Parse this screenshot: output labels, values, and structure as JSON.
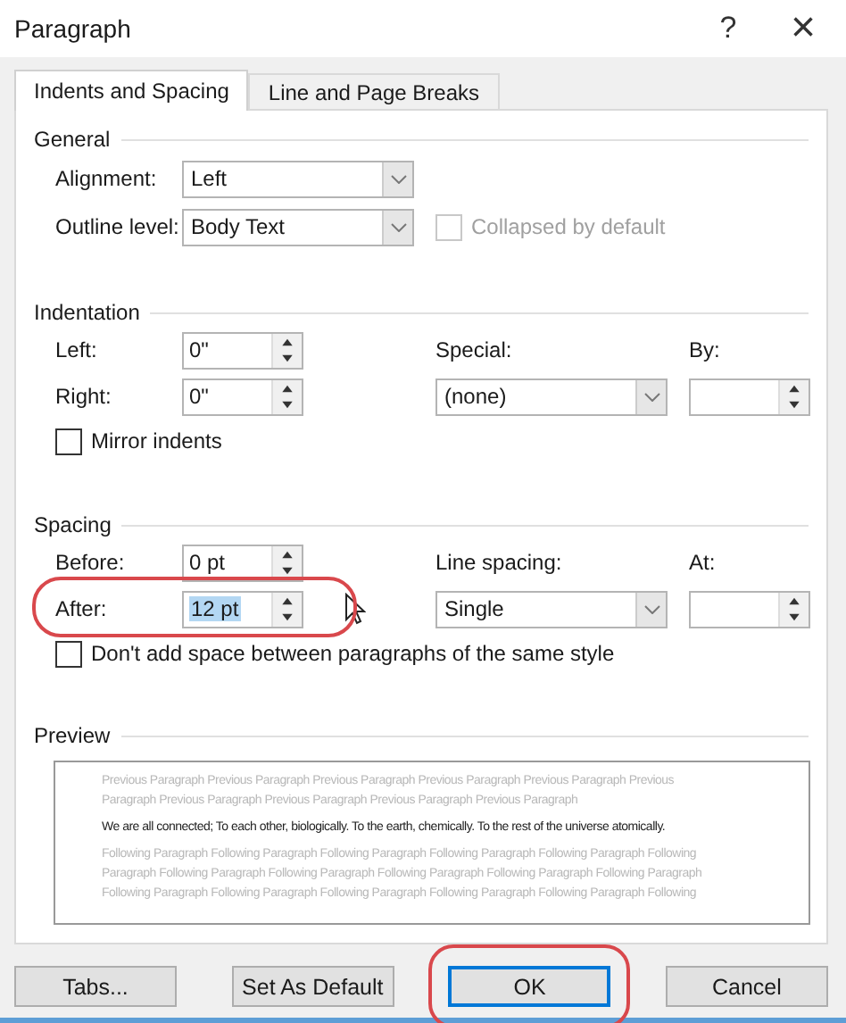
{
  "window": {
    "title": "Paragraph",
    "help": "?",
    "close": "×"
  },
  "tabs": [
    {
      "label": "Indents and Spacing",
      "selected": true
    },
    {
      "label": "Line and Page Breaks",
      "selected": false
    }
  ],
  "general": {
    "title": "General",
    "alignment": {
      "label": "Alignment:",
      "value": "Left"
    },
    "outline_level": {
      "label": "Outline level:",
      "value": "Body Text"
    },
    "collapsed": {
      "label": "Collapsed by default",
      "checked": false,
      "disabled": true
    }
  },
  "indentation": {
    "title": "Indentation",
    "left": {
      "label": "Left:",
      "value": "0\""
    },
    "right": {
      "label": "Right:",
      "value": "0\""
    },
    "special": {
      "label": "Special:",
      "value": "(none)"
    },
    "by": {
      "label": "By:"
    },
    "mirror": {
      "label": "Mirror indents",
      "checked": false
    }
  },
  "spacing": {
    "title": "Spacing",
    "before": {
      "label": "Before:",
      "value": "0 pt"
    },
    "after": {
      "label": "After:",
      "value": "12 pt",
      "text_selected": true,
      "highlighted": true
    },
    "line_spacing": {
      "label": "Line spacing:",
      "value": "Single"
    },
    "at": {
      "label": "At:"
    },
    "dont_add": {
      "label": "Don't add space between paragraphs of the same style",
      "checked": false
    }
  },
  "preview": {
    "title": "Preview",
    "previous": [
      "Previous Paragraph Previous Paragraph Previous Paragraph Previous Paragraph Previous Paragraph Previous",
      "Paragraph Previous Paragraph Previous Paragraph Previous Paragraph Previous Paragraph"
    ],
    "sample": "We are all connected; To each other, biologically. To the earth, chemically. To the rest of the universe atomically.",
    "following": [
      "Following Paragraph Following Paragraph Following Paragraph Following Paragraph Following Paragraph Following",
      "Paragraph Following Paragraph Following Paragraph Following Paragraph Following Paragraph Following Paragraph",
      "Following Paragraph Following Paragraph Following Paragraph Following Paragraph Following Paragraph Following"
    ]
  },
  "buttons": [
    {
      "label": "Tabs...",
      "default": false,
      "highlighted": false
    },
    {
      "label": "Set As Default",
      "default": false,
      "highlighted": false
    },
    {
      "label": "OK",
      "default": true,
      "highlighted": true
    },
    {
      "label": "Cancel",
      "default": false,
      "highlighted": false
    }
  ]
}
